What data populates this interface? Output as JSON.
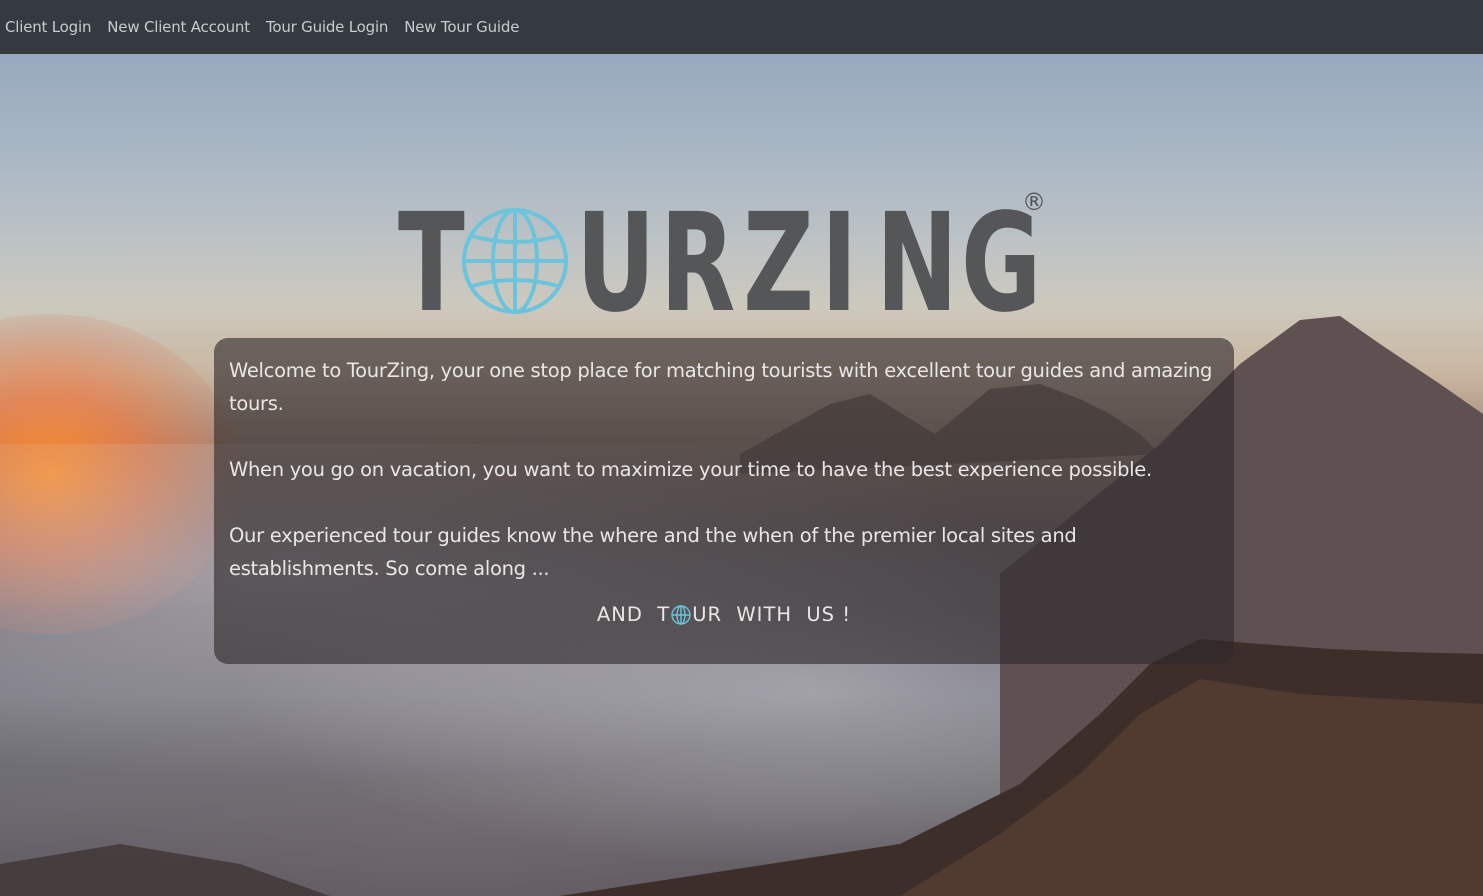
{
  "nav": {
    "items": [
      {
        "label": "Client Login"
      },
      {
        "label": "New Client Account"
      },
      {
        "label": "Tour Guide Login"
      },
      {
        "label": "New Tour Guide"
      }
    ]
  },
  "logo": {
    "letters": [
      "T",
      "U",
      "R",
      "Z",
      "I",
      "N",
      "G"
    ],
    "registered": "®",
    "icon": "globe-icon"
  },
  "intro": {
    "paragraph1": "Welcome to TourZing, your one stop place for matching tourists with excellent tour guides and amazing tours.",
    "paragraph2": "When you go on vacation, you want to maximize your time to have the best experience possible.",
    "paragraph3": "Our experienced tour guides know the where and the when of the premier local sites and establishments. So come along ...",
    "tagline_before": "AND  T",
    "tagline_after": "UR  WITH  US !"
  },
  "colors": {
    "navbar": "#343a40",
    "nav_text": "#c8cbcf",
    "logo_text": "#545657",
    "globe": "#6cc4dc",
    "box_text": "#e9e6e6"
  }
}
